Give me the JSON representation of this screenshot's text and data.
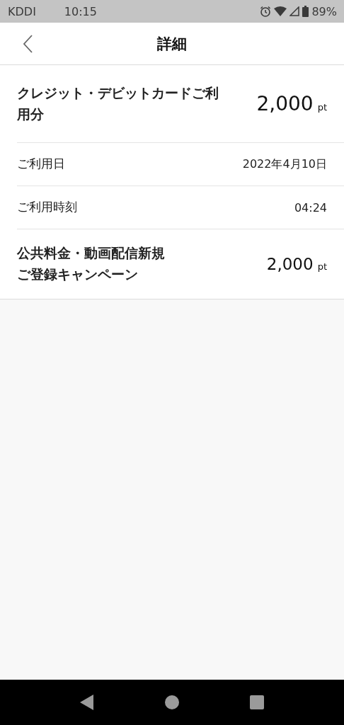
{
  "status_bar": {
    "carrier": "KDDI",
    "time": "10:15",
    "battery": "89%"
  },
  "header": {
    "title": "詳細"
  },
  "rows": [
    {
      "kind": "amount",
      "label": "クレジット・デビットカードご利用分",
      "value": "2,000",
      "unit": "pt",
      "large": true
    },
    {
      "kind": "detail",
      "label": "ご利用日",
      "value": "2022年4月10日"
    },
    {
      "kind": "detail",
      "label": "ご利用時刻",
      "value": "04:24"
    },
    {
      "kind": "amount",
      "label_lines": [
        "公共料金・動画配信新規",
        "ご登録キャンペーン"
      ],
      "value": "2,000",
      "unit": "pt",
      "large": false
    }
  ]
}
